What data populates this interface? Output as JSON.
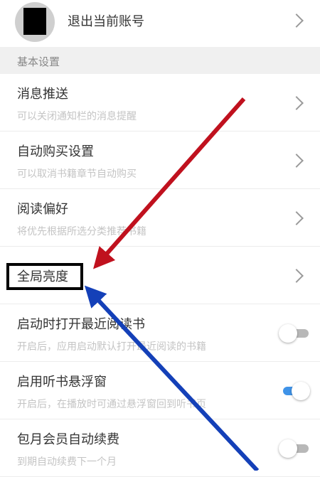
{
  "account": {
    "label": "退出当前账号"
  },
  "section": {
    "title": "基本设置"
  },
  "items": [
    {
      "title": "消息推送",
      "subtitle": "可以关闭通知栏的消息提醒"
    },
    {
      "title": "自动购买设置",
      "subtitle": "可以取消书籍章节自动购买"
    },
    {
      "title": "阅读偏好",
      "subtitle": "将优先根据所选分类推荐书籍"
    },
    {
      "title": "全局亮度"
    },
    {
      "title": "启动时打开最近阅读书",
      "subtitle": "开启后，应用启动默认打开最近阅读的书籍",
      "toggle": "off"
    },
    {
      "title": "启用听书悬浮窗",
      "subtitle": "开启后，在播放时可通过悬浮窗回到听书页",
      "toggle": "on"
    },
    {
      "title": "包月会员自动续费",
      "subtitle": "到期自动续费下一个月",
      "toggle": "off"
    }
  ],
  "colors": {
    "toggle_on": "#3f93e8",
    "arrow_red": "#c0111e",
    "arrow_blue": "#1440b8",
    "section_bg": "#f0f0f0"
  },
  "icons": {
    "chevron": "chevron-right-icon"
  }
}
